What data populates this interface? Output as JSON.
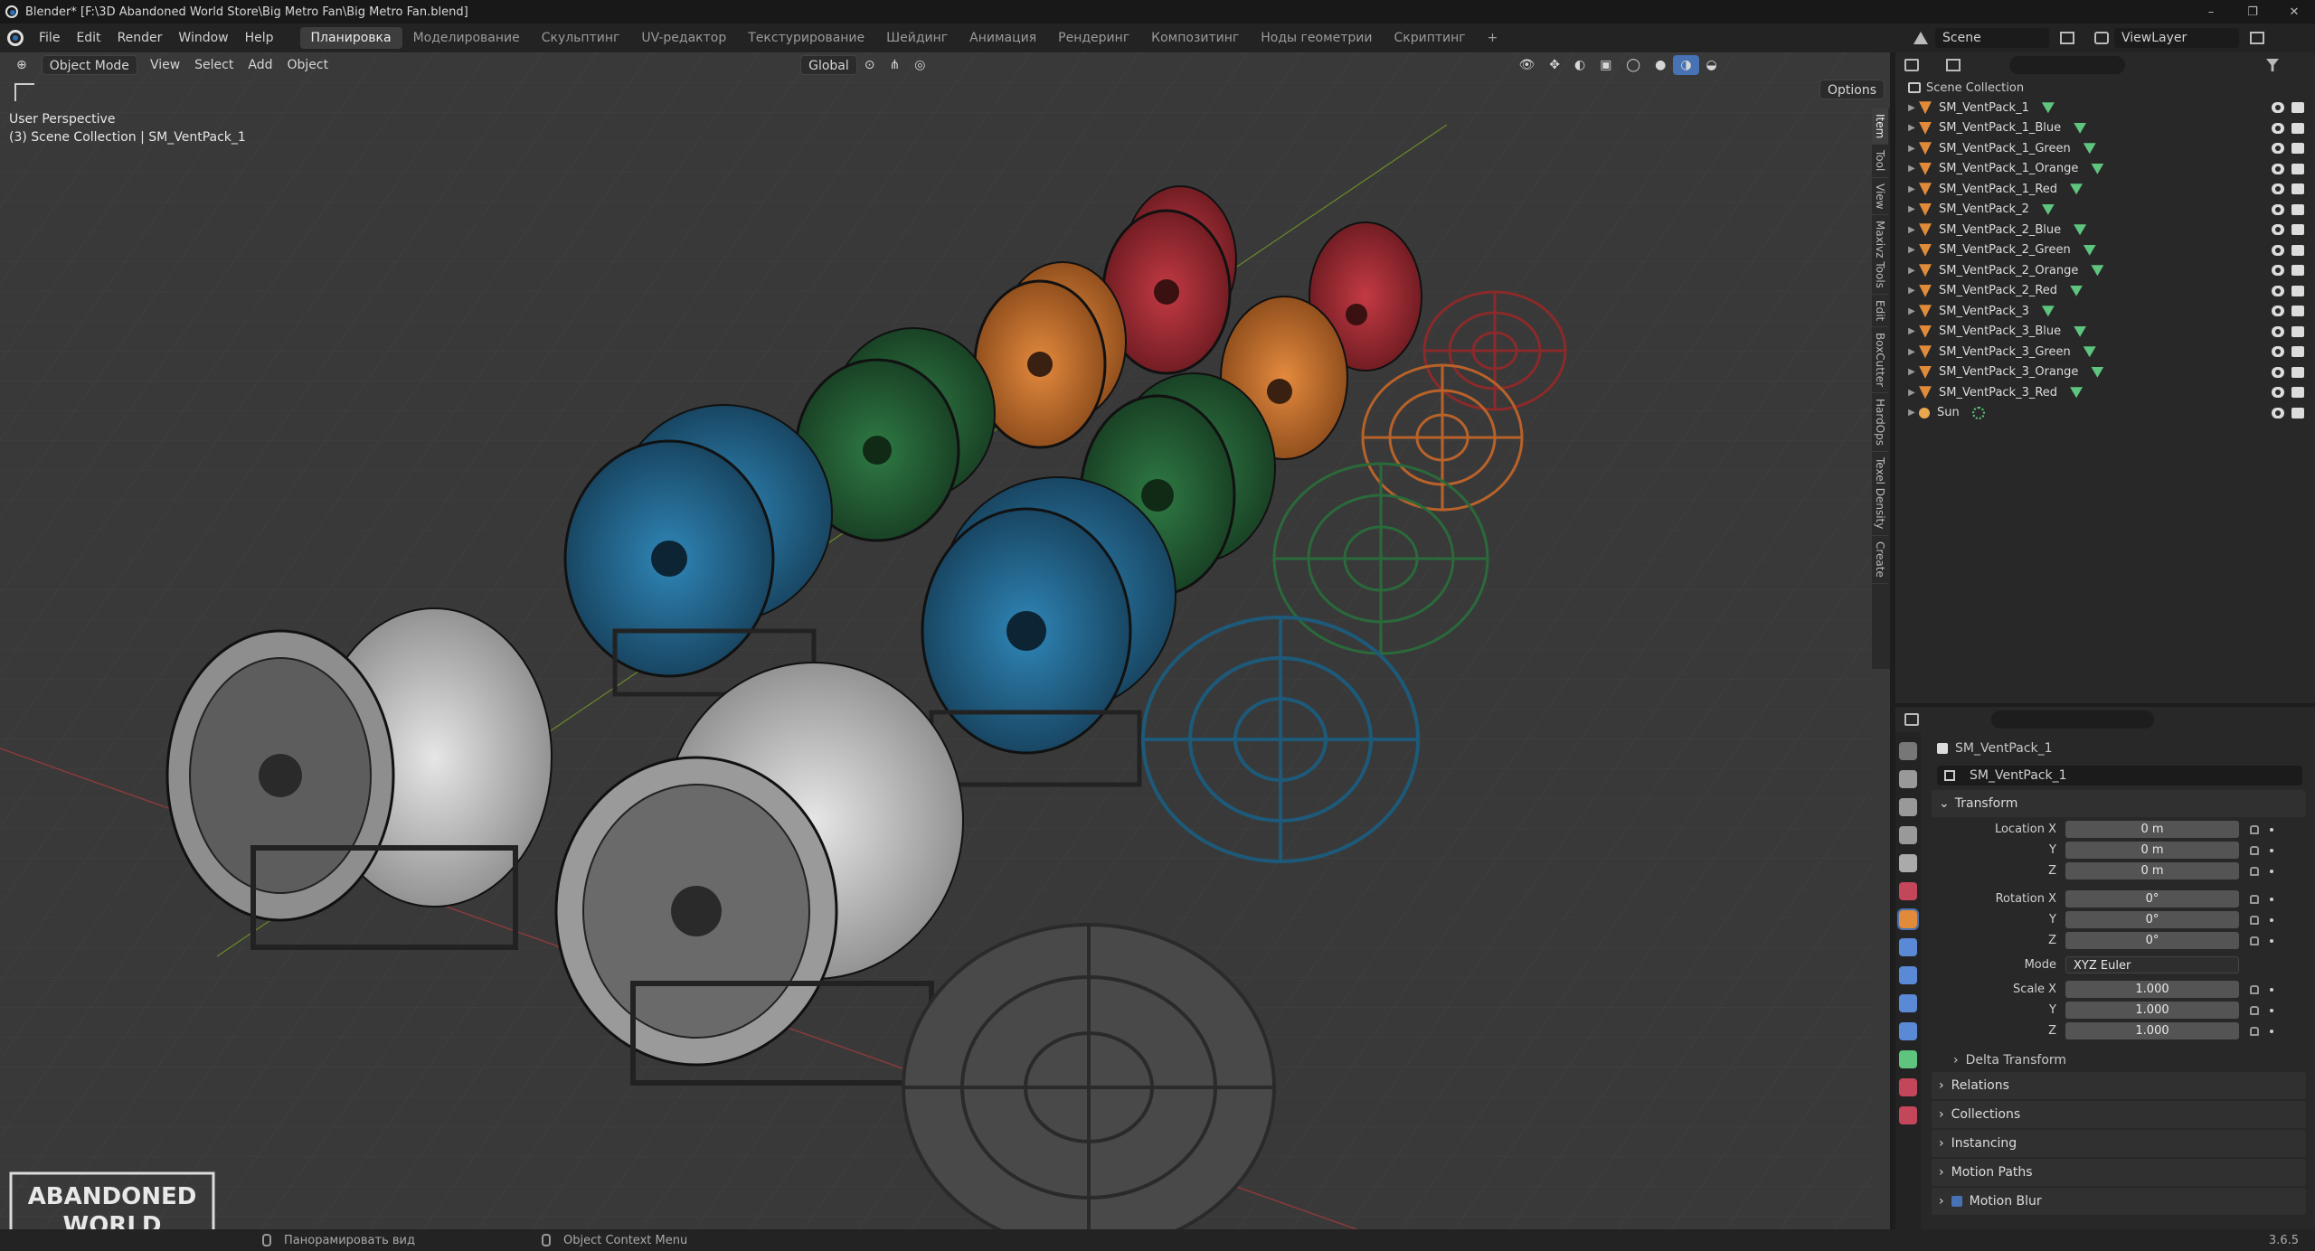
{
  "window": {
    "title": "Blender* [F:\\3D Abandoned World Store\\Big Metro Fan\\Big Metro Fan.blend]",
    "controls": [
      "–",
      "❐",
      "✕"
    ]
  },
  "menu": [
    "File",
    "Edit",
    "Render",
    "Window",
    "Help"
  ],
  "workspaces": [
    "Планировка",
    "Моделирование",
    "Скульптинг",
    "UV-редактор",
    "Текстурирование",
    "Шейдинг",
    "Анимация",
    "Рендеринг",
    "Композитинг",
    "Ноды геометрии",
    "Скриптинг"
  ],
  "workspace_add": "+",
  "scene": {
    "label": "Scene",
    "view_layer": "ViewLayer"
  },
  "viewport": {
    "mode": "Object Mode",
    "menus": [
      "View",
      "Select",
      "Add",
      "Object"
    ],
    "orientation": "Global",
    "options": "Options",
    "perspective": "User Perspective",
    "collection_info": "(3) Scene Collection | SM_VentPack_1",
    "side_tabs": [
      "Item",
      "Tool",
      "View",
      "Maxivz Tools",
      "Edit",
      "BoxCutter",
      "HardOps",
      "Texel Density",
      "Create"
    ],
    "logo_lines": [
      "ABANDONED",
      "WORLD"
    ]
  },
  "outliner": {
    "root": "Scene Collection",
    "items": [
      "SM_VentPack_1",
      "SM_VentPack_1_Blue",
      "SM_VentPack_1_Green",
      "SM_VentPack_1_Orange",
      "SM_VentPack_1_Red",
      "SM_VentPack_2",
      "SM_VentPack_2_Blue",
      "SM_VentPack_2_Green",
      "SM_VentPack_2_Orange",
      "SM_VentPack_2_Red",
      "SM_VentPack_3",
      "SM_VentPack_3_Blue",
      "SM_VentPack_3_Green",
      "SM_VentPack_3_Orange",
      "SM_VentPack_3_Red"
    ],
    "light": "Sun"
  },
  "properties": {
    "object_name": "SM_VentPack_1",
    "data_name": "SM_VentPack_1",
    "transform_label": "Transform",
    "location": {
      "label": "Location X",
      "x": "0 m",
      "y": "0 m",
      "z": "0 m"
    },
    "rotation": {
      "label": "Rotation X",
      "x": "0°",
      "y": "0°",
      "z": "0°"
    },
    "mode_label": "Mode",
    "mode_value": "XYZ Euler",
    "scale": {
      "label": "Scale X",
      "x": "1.000",
      "y": "1.000",
      "z": "1.000"
    },
    "axis_y": "Y",
    "axis_z": "Z",
    "delta": "Delta Transform",
    "panels": [
      "Relations",
      "Collections",
      "Instancing",
      "Motion Paths",
      "Motion Blur"
    ]
  },
  "status": {
    "pan": "Панорамировать вид",
    "context": "Object Context Menu",
    "version": "3.6.5"
  },
  "colors": {
    "accent": "#4772b3",
    "object_orange": "#e08a3a",
    "mesh_green": "#5ec47e"
  }
}
